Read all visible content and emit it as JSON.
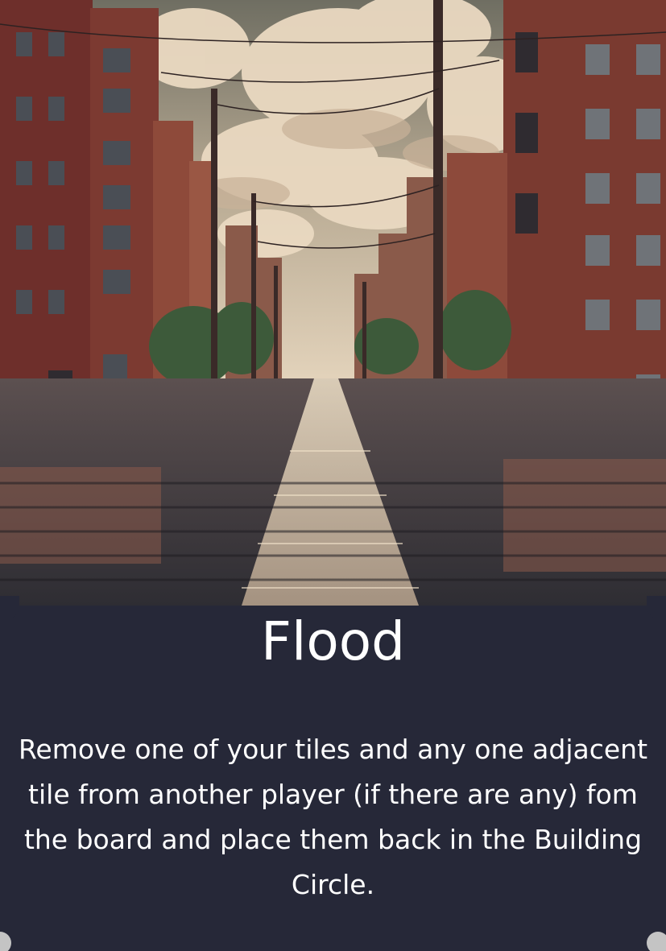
{
  "card": {
    "title": "Flood",
    "rules_text": "Remove one of your tiles and any one adjacent tile from another player (if there are any) fom the board and place them back in the Building Circle."
  },
  "colors": {
    "panel": "#262838",
    "title_text": "#ffffff",
    "brick": "#7a3b30",
    "sky": "#8c8a78",
    "water": "#3c3a3a"
  },
  "art": {
    "subject": "flooded-city-street-illustration"
  }
}
